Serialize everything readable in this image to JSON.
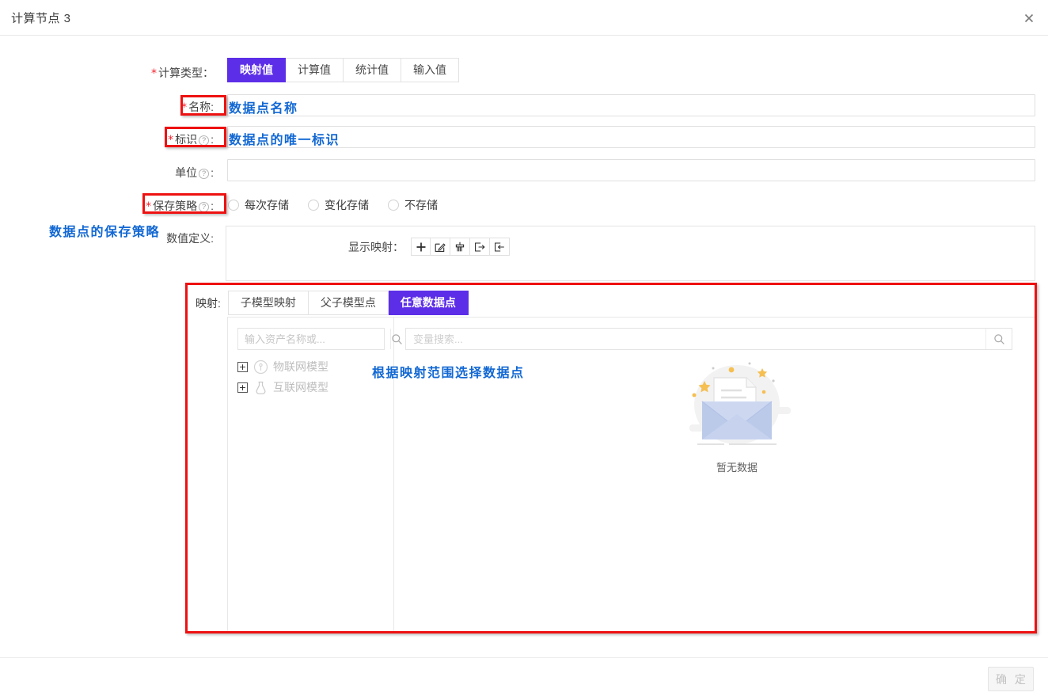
{
  "header": {
    "title": "计算节点 3",
    "close_icon": "close-icon"
  },
  "form": {
    "calc_type": {
      "label": "计算类型：",
      "required": true,
      "options": [
        "映射值",
        "计算值",
        "统计值",
        "输入值"
      ],
      "selected": "映射值"
    },
    "name": {
      "label": "名称:",
      "required": true,
      "value": "",
      "placeholder": ""
    },
    "identifier": {
      "label": "标识",
      "suffix": ":",
      "required": true,
      "help_icon": "question-circle-icon",
      "value": "",
      "placeholder": ""
    },
    "unit": {
      "label": "单位",
      "suffix": ":",
      "required": false,
      "help_icon": "question-circle-icon",
      "value": "",
      "placeholder": ""
    },
    "save_policy": {
      "label": "保存策略",
      "suffix": ":",
      "required": true,
      "help_icon": "question-circle-icon",
      "options": [
        "每次存储",
        "变化存储",
        "不存储"
      ],
      "selected": ""
    },
    "value_def": {
      "label": "数值定义:",
      "toolbar_label": "显示映射：",
      "toolbar_icons": [
        "plus-icon",
        "edit-icon",
        "clear-icon",
        "export-icon",
        "import-icon"
      ]
    },
    "mapping": {
      "label": "映射:",
      "tabs": [
        "子模型映射",
        "父子模型点",
        "任意数据点"
      ],
      "selected": "任意数据点",
      "asset_search": {
        "placeholder": "输入资产名称或...",
        "value": "",
        "icon": "search-icon"
      },
      "variable_search": {
        "placeholder": "变量搜索...",
        "value": "",
        "icon": "search-icon"
      },
      "tree": [
        {
          "label": "物联网模型",
          "icon": "iot-model-icon",
          "expander": "+"
        },
        {
          "label": "互联网模型",
          "icon": "internet-model-icon",
          "expander": "+"
        }
      ],
      "empty": {
        "icon": "empty-envelope-icon",
        "text": "暂无数据"
      }
    }
  },
  "footer": {
    "confirm_label": "确 定",
    "confirm_disabled": true
  },
  "annotations": {
    "name_note": "数据点名称",
    "identifier_note": "数据点的唯一标识",
    "save_policy_note": "数据点的保存策略",
    "mapping_note": "根据映射范围选择数据点"
  },
  "colors": {
    "accent": "#5c2ee8",
    "annotation_box": "#ee1111",
    "annotation_text": "#1268d3",
    "required_star": "#f5222d"
  }
}
